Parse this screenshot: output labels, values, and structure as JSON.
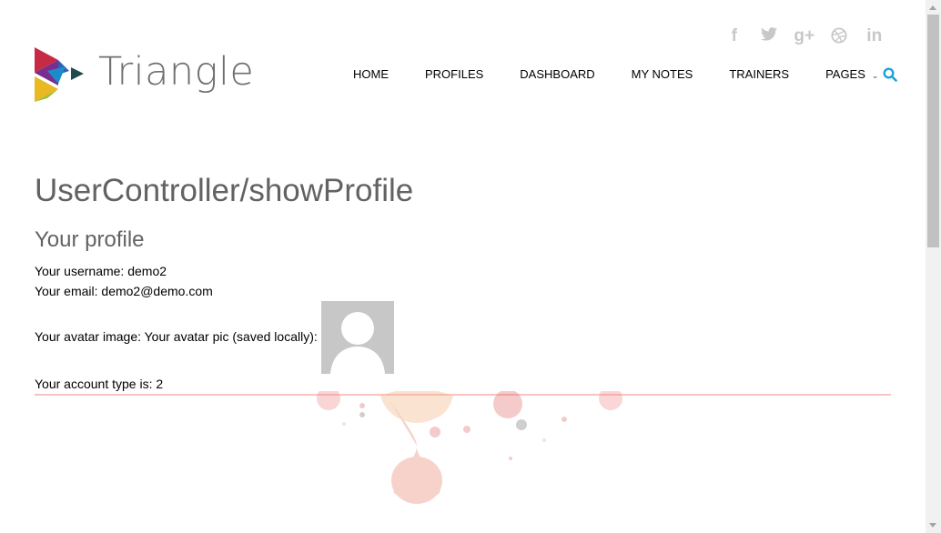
{
  "header": {
    "logo_text": "Triangle",
    "social": [
      {
        "name": "facebook-icon",
        "glyph": "f"
      },
      {
        "name": "twitter-icon",
        "glyph": "🐦"
      },
      {
        "name": "google-plus-icon",
        "glyph": "g+"
      },
      {
        "name": "dribbble-icon",
        "glyph": "⊛"
      },
      {
        "name": "linkedin-icon",
        "glyph": "in"
      }
    ],
    "nav": {
      "home": "HOME",
      "profiles": "PROFILES",
      "dashboard": "DASHBOARD",
      "my_notes": "MY NOTES",
      "trainers": "TRAINERS",
      "pages": "PAGES"
    },
    "accent_color": "#1aa4d9"
  },
  "content": {
    "page_title": "UserController/showProfile",
    "section_title": "Your profile",
    "username_line": "Your username: demo2",
    "email_line": "Your email: demo2@demo.com",
    "avatar_line": "Your avatar image: Your avatar pic (saved locally):",
    "account_type_line": "Your account type is: 2"
  }
}
